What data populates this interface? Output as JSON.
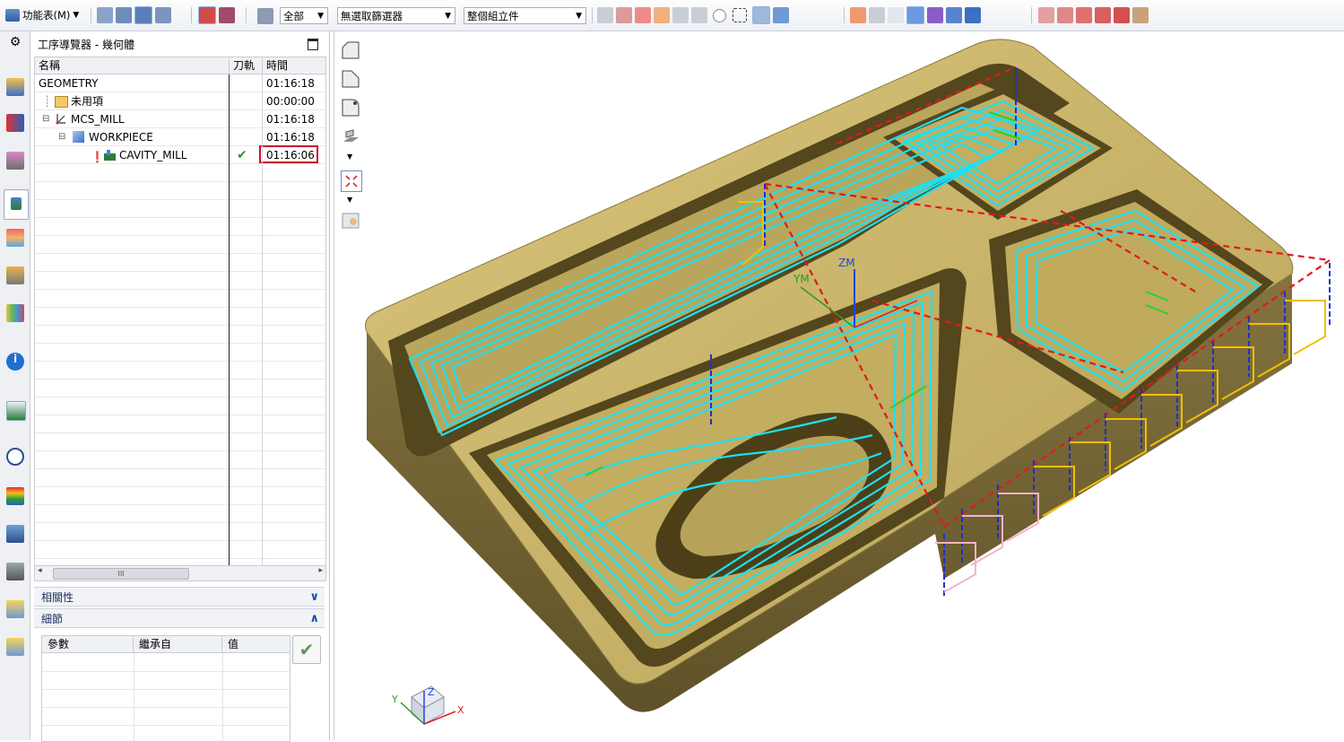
{
  "toolbar": {
    "menu_label": "功能表(M)",
    "filter_all": "全部",
    "selection_filter": "無選取篩選器",
    "assembly_scope": "整個組立件"
  },
  "navigator": {
    "title": "工序導覽器 - 幾何體",
    "columns": {
      "name": "名稱",
      "toolpath": "刀軌",
      "time": "時間"
    },
    "rows": [
      {
        "name": "GEOMETRY",
        "time": "01:16:18",
        "indent": 0,
        "icon": "none"
      },
      {
        "name": "未用項",
        "time": "00:00:00",
        "indent": 1,
        "icon": "folder-icon"
      },
      {
        "name": "MCS_MILL",
        "time": "01:16:18",
        "indent": 1,
        "icon": "mcs-icon"
      },
      {
        "name": "WORKPIECE",
        "time": "01:16:18",
        "indent": 2,
        "icon": "workpiece-icon"
      },
      {
        "name": "CAVITY_MILL",
        "time": "01:16:06",
        "indent": 3,
        "icon": "cavity-mill-icon",
        "toolpath_ok": true
      }
    ],
    "dependencies_label": "相關性",
    "details_label": "細節",
    "details_columns": {
      "param": "參數",
      "inherit": "繼承自",
      "value": "值"
    },
    "scroll_thumb": "III"
  },
  "viewport": {
    "wcs_labels": {
      "ym": "YM",
      "zm": "ZM"
    },
    "triad": {
      "x": "X",
      "y": "Y",
      "z": "Z"
    }
  },
  "colors": {
    "part_top": "#c8b46a",
    "part_side": "#6f5f2f",
    "toolpath": "#1ee0f0",
    "rapid": "#e01a1a",
    "engage": "#f0c000",
    "highlight_box": "#c8102e"
  }
}
